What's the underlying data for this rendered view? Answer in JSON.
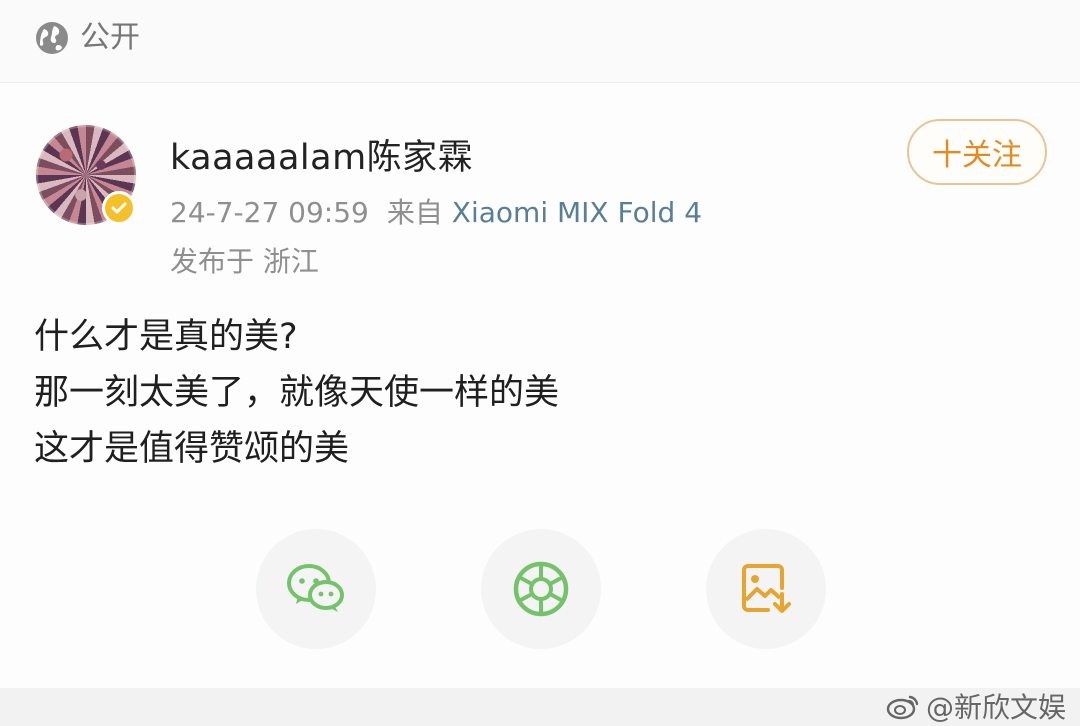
{
  "header": {
    "visibility_label": "公开",
    "visibility_icon": "globe-icon"
  },
  "post": {
    "author": {
      "name": "kaaaaalam陈家霖",
      "avatar_icon": "avatar",
      "verified_badge": "verified-badge-icon"
    },
    "meta": {
      "timestamp": "24-7-27 09:59",
      "source_prefix": "来自",
      "device": "Xiaomi MIX Fold 4"
    },
    "location": "发布于 浙江",
    "follow_label": "十关注",
    "content_lines": [
      "什么才是真的美?",
      "那一刻太美了，就像天使一样的美",
      "这才是值得赞颂的美"
    ]
  },
  "share": {
    "wechat_icon": "wechat-icon",
    "moments_icon": "moments-icon",
    "save_image_icon": "save-image-icon"
  },
  "watermark": {
    "text": "@新欣文娱",
    "icon": "weibo-logo-icon"
  },
  "colors": {
    "accent": "#e48a22",
    "follow_border": "#e9c595",
    "device_text": "#587f96",
    "verify_badge": "#f4c12b",
    "wechat_green": "#74c36b"
  }
}
